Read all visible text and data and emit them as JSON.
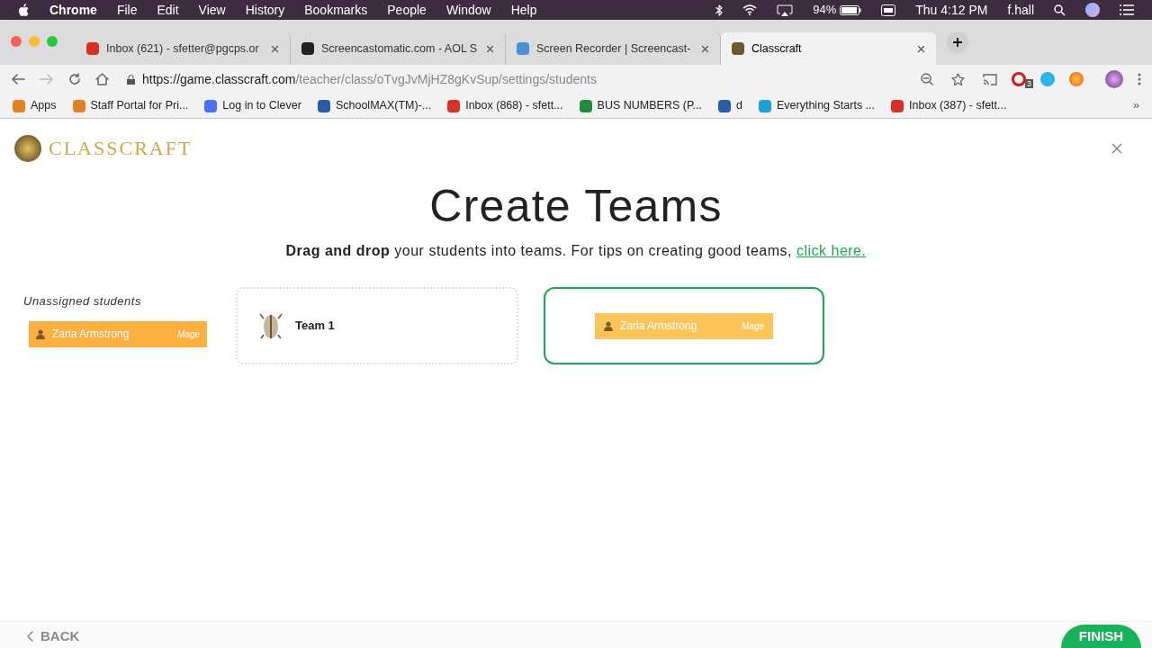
{
  "menu_bar": {
    "app": "Chrome",
    "items": [
      "File",
      "Edit",
      "View",
      "History",
      "Bookmarks",
      "People",
      "Window",
      "Help"
    ],
    "battery": "94%",
    "clock": "Thu 4:12 PM",
    "user": "f.hall"
  },
  "tabs": [
    {
      "title": "Inbox (621) - sfetter@pgcps.or",
      "selected": false
    },
    {
      "title": "Screencastomatic.com - AOL S",
      "selected": false
    },
    {
      "title": "Screen Recorder | Screencast-",
      "selected": false
    },
    {
      "title": "Classcraft",
      "selected": true
    }
  ],
  "address": {
    "host": "https://game.classcraft.com",
    "path": "/teacher/class/oTvgJvMjHZ8gKvSup/settings/students"
  },
  "extension_badge": "3",
  "bookmarks": [
    "Apps",
    "Staff Portal for Pri...",
    "Log in to Clever",
    "SchoolMAX(TM)-...",
    "Inbox (868) - sfett...",
    "BUS NUMBERS (P...",
    "d",
    "Everything Starts ...",
    "Inbox (387) - sfett..."
  ],
  "overflow": "»",
  "logo": "CLASSCRAFT",
  "heading": "Create Teams",
  "instructions": {
    "text": "**Drag and drop** your students into teams. For tips on creating good teams,",
    "link": "click here."
  },
  "unassigned": {
    "label": "Unassigned students",
    "students": [
      {
        "name": "Zaria Armstrong",
        "class": "Mage"
      }
    ]
  },
  "teams": [
    {
      "name": "Team 1"
    }
  ],
  "drop_zone": {
    "dragged": {
      "name": "Zaria Armstrong",
      "class": "Mage"
    }
  },
  "footer": {
    "back": "BACK",
    "finish": "FINISH"
  }
}
